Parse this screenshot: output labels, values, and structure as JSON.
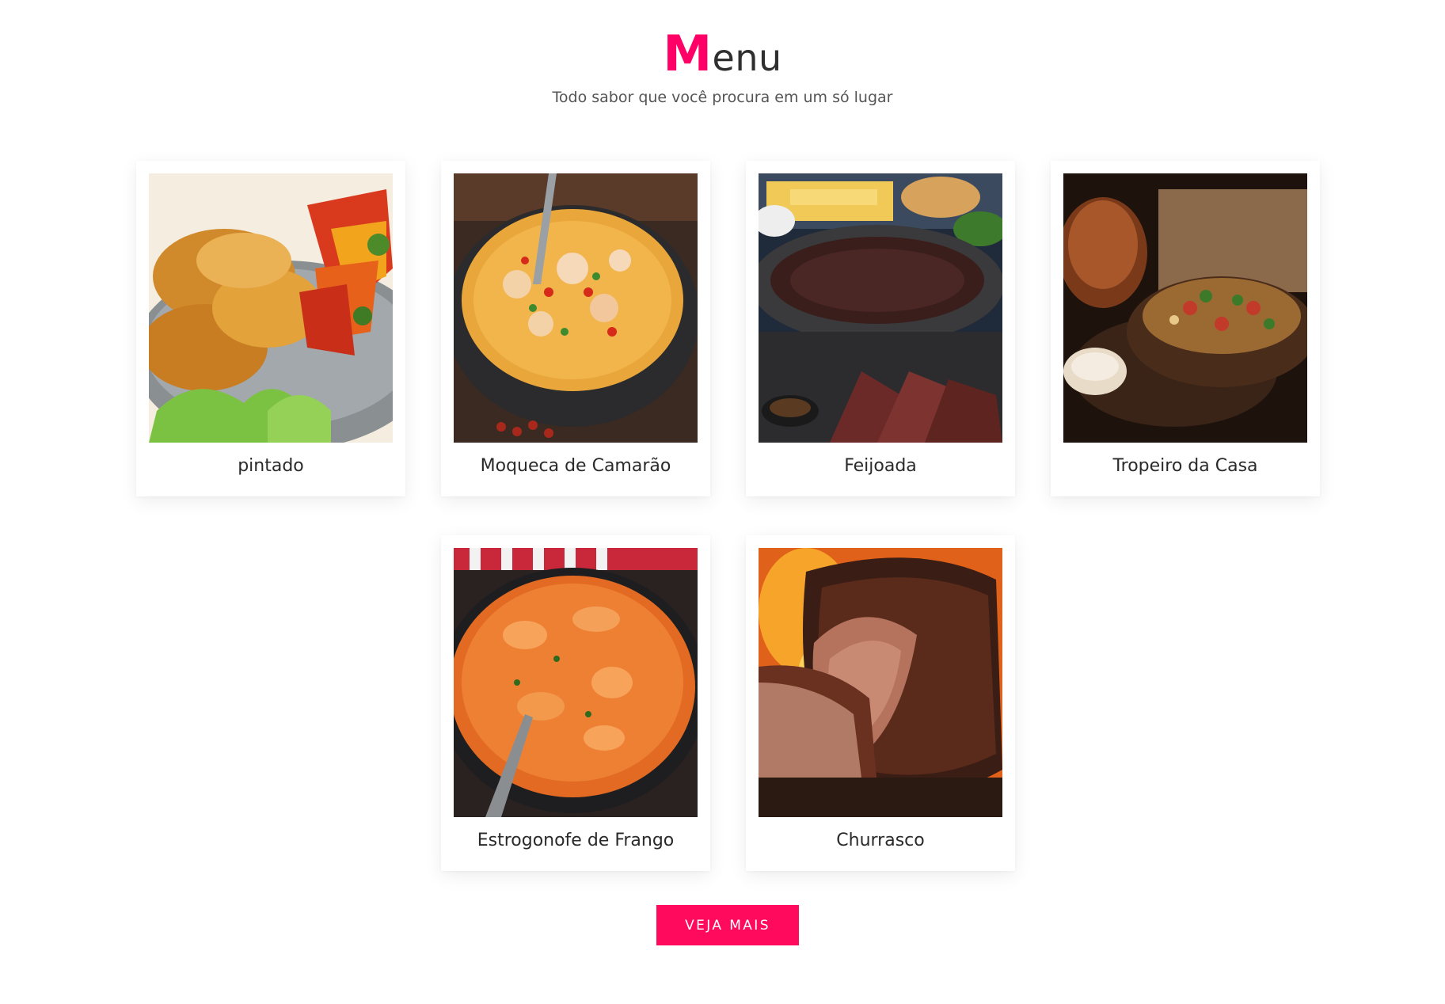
{
  "header": {
    "title_first_letter": "M",
    "title_rest": "enu",
    "subtitle": "Todo sabor que você procura em um só lugar"
  },
  "menu": {
    "items": [
      {
        "name": "pintado",
        "image": "pintado-dish-photo"
      },
      {
        "name": "Moqueca de Camarão",
        "image": "moqueca-dish-photo"
      },
      {
        "name": "Feijoada",
        "image": "feijoada-dish-photo"
      },
      {
        "name": "Tropeiro da Casa",
        "image": "tropeiro-dish-photo"
      },
      {
        "name": "Estrogonofe de Frango",
        "image": "estrogonofe-dish-photo"
      },
      {
        "name": "Churrasco",
        "image": "churrasco-dish-photo"
      }
    ]
  },
  "cta": {
    "label": "VEJA MAIS"
  },
  "colors": {
    "accent": "#ff0a5c",
    "text": "#2b2b2b",
    "background": "#ffffff"
  }
}
